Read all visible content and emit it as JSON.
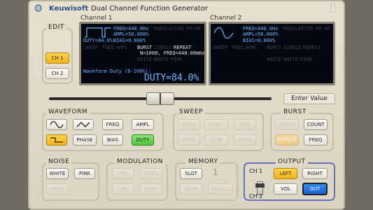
{
  "app": {
    "brand": "Keuwisoft",
    "title": "Dual Channel Function Generator"
  },
  "channels": {
    "ch1_label": "Channel 1",
    "ch2_label": "Channel 2"
  },
  "screen1": {
    "freq": "FREQ=440.0Hz",
    "ampl": "AMPL=50.000%",
    "duty": "DUTY=84.0%",
    "bias": "BIAS=0.000%",
    "modulation": "MODULATION",
    "fm": "FM",
    "am": "AM",
    "burst": "BURST",
    "single": "SINGLE",
    "repeat": "REPEAT",
    "burst_info": "N=1000, FREQ=440.00mHz",
    "sweep": "SWEEP",
    "freq_label": "FREQ",
    "ampl_label": "AMPL",
    "noise": "NOISE",
    "white": "WHITE",
    "pink": "PINK",
    "duty_prompt": "Waveform Duty (0-100%):",
    "duty_big": "DUTY=84.0%"
  },
  "screen2": {
    "freq": "FREQ=440.0Hz",
    "ampl": "AMPL=50.000%",
    "bias": "BIAS=0.000%",
    "modulation": "MODULATION",
    "fm": "FM",
    "am": "AM",
    "sweep": "SWEEP",
    "freq_label": "FREQ",
    "ampl_label": "AMPL",
    "burst": "BURST",
    "single": "SINGLE",
    "repeat": "REPEAT",
    "noise": "NOISE",
    "white": "WHITE",
    "pink": "PINK"
  },
  "edit": {
    "title": "EDIT",
    "ch1": "CH 1",
    "ch2": "CH 2"
  },
  "slider": {
    "position": 0.5
  },
  "enter_value": "Enter Value",
  "waveform": {
    "title": "WAVEFORM",
    "freq": "FREQ",
    "ampl": "AMPL",
    "phase": "PHASE",
    "bias": "BIAS",
    "duty": "DUTY"
  },
  "sweep": {
    "title": "SWEEP",
    "freq": "FREQ",
    "start": "START",
    "end": "END",
    "ampl": "AMPL",
    "stop": "STOP",
    "mode": "MODE"
  },
  "burst": {
    "title": "BURST",
    "single": "SINGLE",
    "count": "COUNT",
    "repeat": "REPEAT",
    "freq": "FREQ"
  },
  "noise": {
    "title": "NOISE",
    "white": "WHITE",
    "pink": "PINK",
    "ampl": "AMPL"
  },
  "modulation": {
    "title": "MODULATION",
    "fm": "FM",
    "freq1": "FREQ",
    "am": "AM",
    "ampl": "AMPL"
  },
  "memory": {
    "title": "MEMORY",
    "slot": "SLOT",
    "slot_value": "1",
    "save": "SAVE",
    "recall": "RECALL"
  },
  "output": {
    "title": "OUTPUT",
    "ch1": "CH 1",
    "ch2": "CH 2",
    "left": "LEFT",
    "right": "RIGHT",
    "vol": "VOL",
    "out": "OUT"
  },
  "colors": {
    "accent_orange": "#f1b419",
    "accent_green": "#4fc33c",
    "accent_blue": "#1a5fd0",
    "screen_text": "#6fb6ff"
  }
}
